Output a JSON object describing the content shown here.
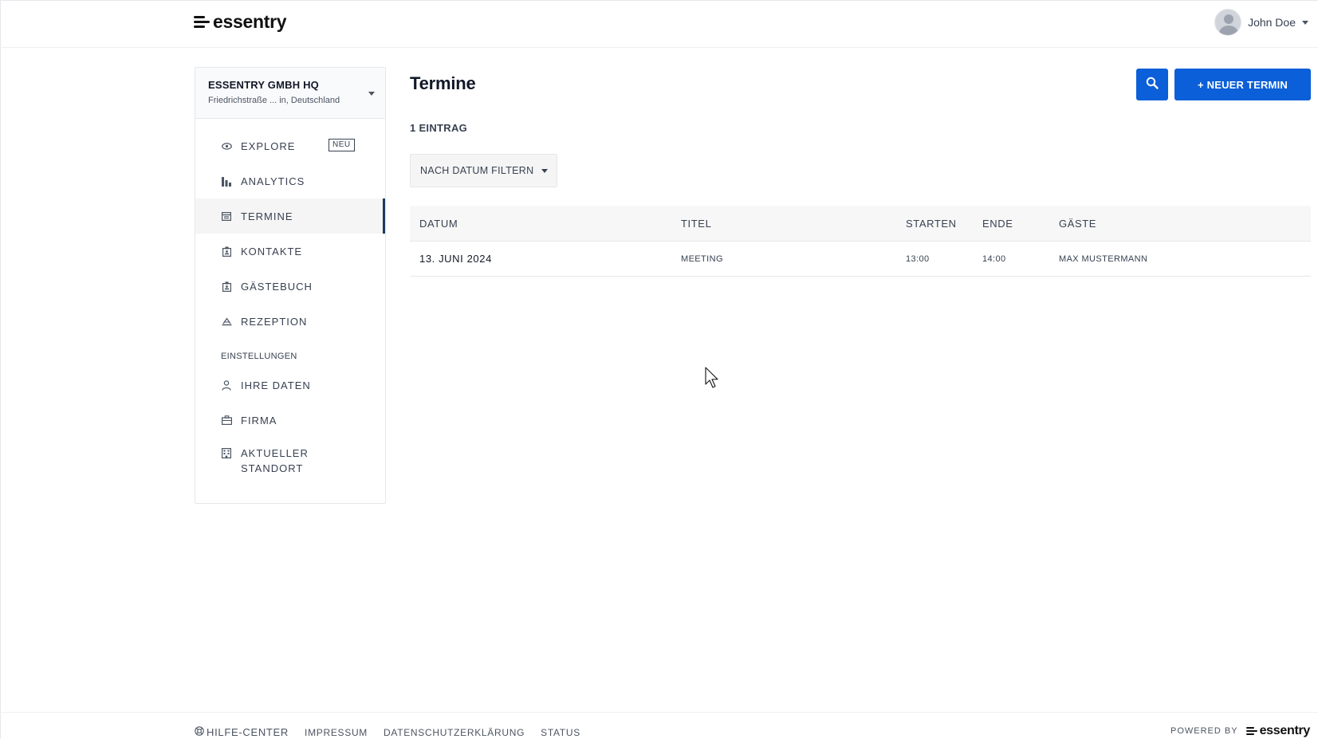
{
  "brand": {
    "name": "essentry"
  },
  "user": {
    "name": "John Doe"
  },
  "location": {
    "name": "ESSENTRY GMBH HQ",
    "address": "Friedrichstraße ... in, Deutschland"
  },
  "nav": {
    "items": [
      {
        "label": "EXPLORE",
        "icon": "eye-icon",
        "badge": "NEU"
      },
      {
        "label": "ANALYTICS",
        "icon": "bar-chart-icon"
      },
      {
        "label": "TERMINE",
        "icon": "calendar-icon",
        "active": true
      },
      {
        "label": "KONTAKTE",
        "icon": "contact-badge-icon"
      },
      {
        "label": "GÄSTEBUCH",
        "icon": "guestbook-icon"
      },
      {
        "label": "REZEPTION",
        "icon": "reception-bell-icon"
      }
    ],
    "settings_title": "EINSTELLUNGEN",
    "settings_items": [
      {
        "label": "IHRE DATEN",
        "icon": "person-icon"
      },
      {
        "label": "FIRMA",
        "icon": "briefcase-icon"
      },
      {
        "label": "AKTUELLER STANDORT",
        "icon": "building-icon"
      }
    ]
  },
  "main": {
    "title": "Termine",
    "new_button": "+ NEUER TERMIN",
    "count": "1 EINTRAG",
    "filter_label": "NACH DATUM FILTERN"
  },
  "table": {
    "headers": [
      "DATUM",
      "TITEL",
      "STARTEN",
      "ENDE",
      "GÄSTE"
    ],
    "rows": [
      [
        "13. JUNI 2024",
        "MEETING",
        "13:00",
        "14:00",
        "MAX MUSTERMANN"
      ]
    ]
  },
  "footer": {
    "links": [
      "HILFE-CENTER",
      "IMPRESSUM",
      "DATENSCHUTZERKLÄRUNG",
      "STATUS"
    ],
    "powered_by": "POWERED BY"
  },
  "colors": {
    "primary": "#0b5fd8",
    "active_indicator": "#1e3a5f"
  }
}
